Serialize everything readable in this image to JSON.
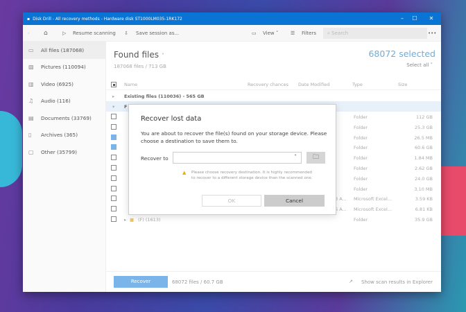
{
  "window": {
    "title": "Disk Drill - All recovery methods - Hardware disk ST1000LM035-1RK172"
  },
  "toolbar": {
    "resume": "Resume scanning",
    "save": "Save session as...",
    "view": "View",
    "filters": "Filters",
    "search_placeholder": "Search"
  },
  "sidebar": {
    "items": [
      {
        "label": "All files (187068)",
        "icon": "all-files-icon"
      },
      {
        "label": "Pictures (110094)",
        "icon": "pictures-icon"
      },
      {
        "label": "Video (6925)",
        "icon": "video-icon"
      },
      {
        "label": "Audio (116)",
        "icon": "audio-icon"
      },
      {
        "label": "Documents (33769)",
        "icon": "documents-icon"
      },
      {
        "label": "Archives (365)",
        "icon": "archives-icon"
      },
      {
        "label": "Other (35799)",
        "icon": "other-icon"
      }
    ]
  },
  "main": {
    "title": "Found files",
    "subtitle": "187068 files / 713 GB",
    "selected": "68072 selected",
    "select_all": "Select all",
    "columns": [
      "Name",
      "Recovery chances",
      "Date Modified",
      "Type",
      "Size"
    ],
    "group_existing": "Existing files (110036) - 565 GB",
    "group_found_partial": "F",
    "rows": [
      {
        "check": "partial",
        "date": "",
        "type": "Folder",
        "size": "112 GB",
        "name": ""
      },
      {
        "check": "off",
        "date": "",
        "type": "Folder",
        "size": "25.3 GB",
        "name": ""
      },
      {
        "check": "on",
        "date": "",
        "type": "Folder",
        "size": "26.5 MB",
        "name": ""
      },
      {
        "check": "on",
        "date": "",
        "type": "Folder",
        "size": "60.6 GB",
        "name": ""
      },
      {
        "check": "off",
        "date": "",
        "type": "Folder",
        "size": "1.84 MB",
        "name": ""
      },
      {
        "check": "off",
        "date": "",
        "type": "Folder",
        "size": "2.62 GB",
        "name": ""
      },
      {
        "check": "off",
        "date": "",
        "type": "Folder",
        "size": "24.0 GB",
        "name": ""
      },
      {
        "check": "off",
        "date": "",
        "type": "Folder",
        "size": "3.10 MB",
        "name": ""
      },
      {
        "check": "off",
        "date": "3 A...",
        "type": "Microsoft Excel...",
        "size": "3.59 KB",
        "name": ""
      },
      {
        "check": "off",
        "date": "6 A...",
        "type": "Microsoft Excel...",
        "size": "6.81 KB",
        "name": ""
      },
      {
        "check": "off",
        "date": "",
        "type": "Folder",
        "size": "35.9 GB",
        "name": "(F) (1613)"
      }
    ]
  },
  "footer": {
    "recover": "Recover",
    "summary": "68072 files / 60.7 GB",
    "explorer": "Show scan results in Explorer"
  },
  "dialog": {
    "title": "Recover lost data",
    "description": "You are about to recover the file(s) found on your storage device. Please choose a destination to save them to.",
    "recover_to": "Recover to",
    "warning": "Please choose recovery destination. It is highly recommended to recover to a different storage device than the scanned one.",
    "ok": "OK",
    "cancel": "Cancel"
  },
  "colors": {
    "titlebar": "#0a74d4",
    "accent": "#7ab4e8"
  }
}
